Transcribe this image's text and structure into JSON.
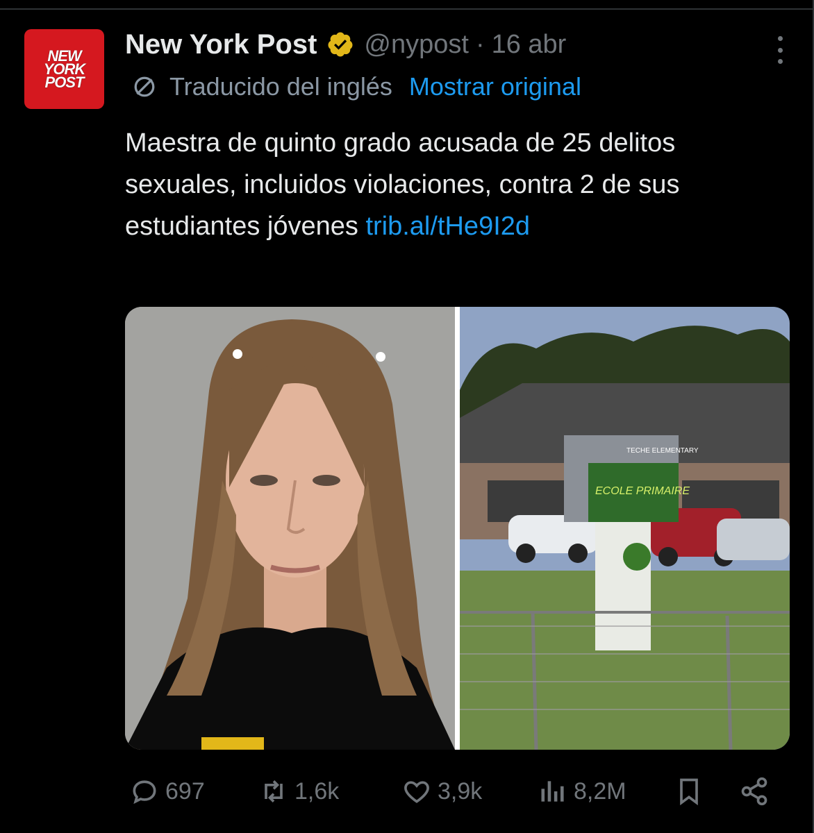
{
  "account": {
    "avatar_text": "NEW YORK POST",
    "name": "New York Post",
    "handle": "@nypost",
    "separator": "·",
    "date": "16 abr"
  },
  "translation": {
    "label": "Traducido del inglés",
    "show_original": "Mostrar original"
  },
  "tweet": {
    "text": "Maestra de quinto grado acusada de 25 delitos sexuales, incluidos violaciones, contra 2 de sus estudiantes jóvenes ",
    "link": "trib.al/tHe9I2d"
  },
  "media": {
    "left_alt": "mugshot-photo",
    "right_alt": "school-building-photo",
    "sign_top_text": "TECHE ELEMENTARY",
    "sign_board_text": "ECOLE PRIMAIRE"
  },
  "actions": {
    "replies": "697",
    "reposts": "1,6k",
    "likes": "3,9k",
    "views": "8,2M"
  },
  "colors": {
    "background": "#000000",
    "text": "#e7e9ea",
    "muted": "#71767b",
    "link": "#1d9bf0",
    "brand_red": "#d5181f",
    "verified_gold": "#e2b719"
  }
}
